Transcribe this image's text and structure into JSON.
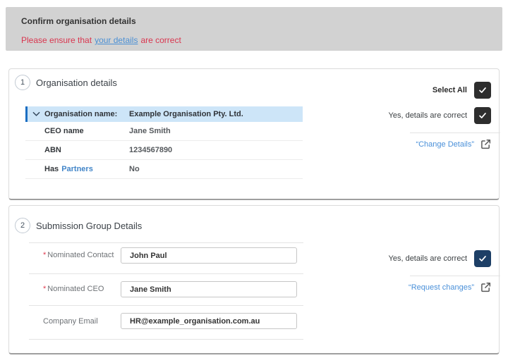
{
  "banner": {
    "title": "Confirm organisation details",
    "warning_prefix": "Please ensure that",
    "warning_link": "your details",
    "warning_suffix": "are correct"
  },
  "section1": {
    "number": "1",
    "title": "Organisation details",
    "select_all_label": "Select All",
    "confirm_label": "Yes, details are correct",
    "change_link": "“Change Details”",
    "table": {
      "rows": [
        {
          "label": "Organisation name:",
          "value": "Example Organisation Pty. Ltd."
        },
        {
          "label": "CEO name",
          "value": "Jane Smith"
        },
        {
          "label": "ABN",
          "value": "1234567890"
        },
        {
          "label_prefix": "Has",
          "label_link": "Partners",
          "value": "No"
        }
      ]
    }
  },
  "section2": {
    "number": "2",
    "title": "Submission Group Details",
    "confirm_label": "Yes, details are correct",
    "request_link": "“Request changes”",
    "fields": [
      {
        "label": "Nominated Contact",
        "required_marker": "*",
        "value": "John Paul"
      },
      {
        "label": "Nominated CEO",
        "required_marker": "*",
        "value": "Jane Smith"
      },
      {
        "label": "Company Email",
        "value": "HR@example_organisation.com.au"
      }
    ]
  },
  "colors": {
    "banner_bg": "#d2d2d2",
    "warning_red": "#d9364f",
    "link_blue": "#4a90d9",
    "highlight_row_bg": "#cde5f8",
    "highlight_accent_bar": "#1b6ec2",
    "checkbox_dark": "#2e2e2e",
    "checkbox_navy": "#1d3f66"
  }
}
